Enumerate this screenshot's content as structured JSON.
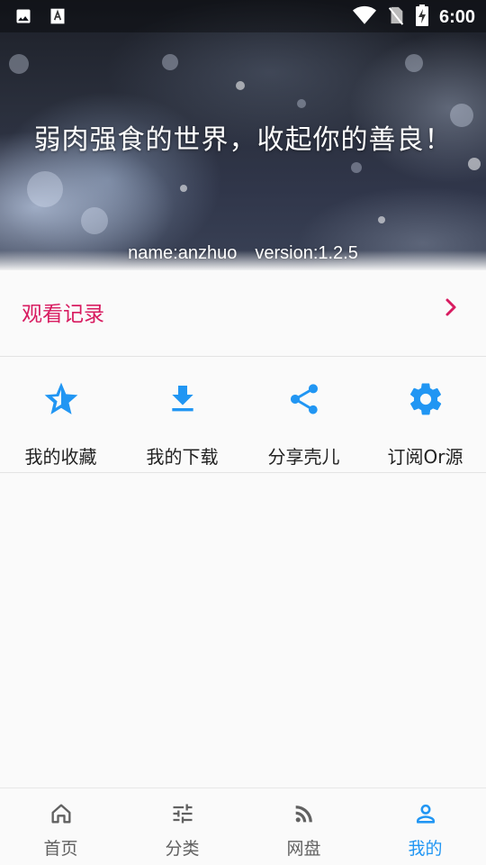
{
  "status_bar": {
    "time": "6:00",
    "left_icons": [
      "image-icon",
      "font-icon"
    ],
    "right_icons": [
      "wifi-icon",
      "no-sim-icon",
      "battery-charging-icon"
    ]
  },
  "header": {
    "title": "弱肉强食的世界，收起你的善良！",
    "name_text": "name:anzhuo",
    "version_text": "version:1.2.5"
  },
  "history": {
    "label": "观看记录",
    "accent_color": "#d81b60"
  },
  "actions": [
    {
      "label": "我的收藏",
      "icon": "star-icon"
    },
    {
      "label": "我的下载",
      "icon": "download-icon"
    },
    {
      "label": "分享壳儿",
      "icon": "share-icon"
    },
    {
      "label": "订阅Or源",
      "icon": "gear-icon"
    }
  ],
  "bottom_nav": {
    "items": [
      {
        "label": "首页",
        "icon": "home-icon",
        "active": false
      },
      {
        "label": "分类",
        "icon": "tune-icon",
        "active": false
      },
      {
        "label": "网盘",
        "icon": "rss-icon",
        "active": false
      },
      {
        "label": "我的",
        "icon": "person-icon",
        "active": true
      }
    ],
    "active_color": "#2196f3",
    "inactive_color": "#616161"
  },
  "colors": {
    "icon_blue": "#2196f3",
    "background": "#fafafa"
  }
}
